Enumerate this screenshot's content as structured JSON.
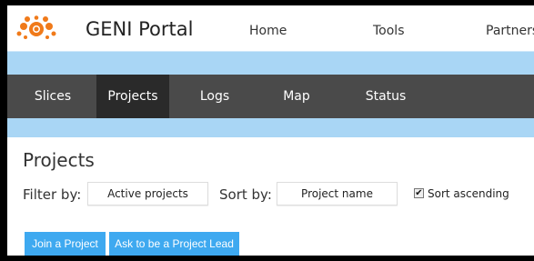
{
  "header": {
    "brand": "GENI Portal",
    "nav": [
      "Home",
      "Tools",
      "Partners"
    ]
  },
  "tabs": [
    {
      "label": "Slices",
      "active": false
    },
    {
      "label": "Projects",
      "active": true
    },
    {
      "label": "Logs",
      "active": false
    },
    {
      "label": "Map",
      "active": false
    },
    {
      "label": "Status",
      "active": false
    }
  ],
  "page": {
    "title": "Projects",
    "filter_label": "Filter by:",
    "filter_value": "Active projects",
    "sort_label": "Sort by:",
    "sort_value": "Project name",
    "sort_ascending_label": "Sort ascending",
    "sort_ascending_checked": true,
    "check_mark": "✔"
  },
  "buttons": {
    "join": "Join a Project",
    "lead": "Ask to be a Project Lead"
  },
  "colors": {
    "accent_blue": "#3ea9f0",
    "nav_bg": "#4a4a4a",
    "nav_active": "#2a2a2a",
    "band_blue": "#a9d6f5",
    "logo_orange": "#f07a1a"
  }
}
